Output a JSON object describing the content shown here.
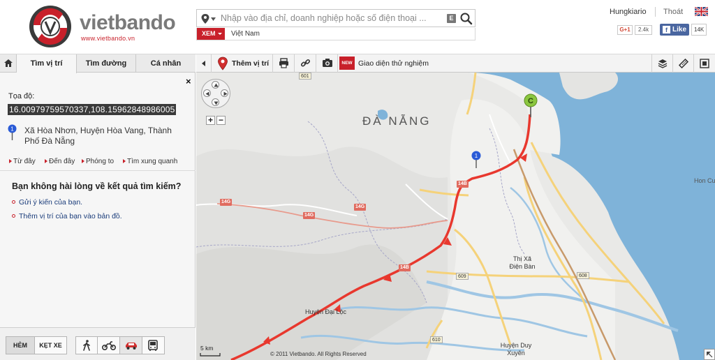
{
  "brand": {
    "name": "vietbando",
    "url": "www.vietbando.vn"
  },
  "search": {
    "placeholder": "Nhập vào địa chỉ, doanh nghiệp hoặc số điện thoại ...",
    "keyboard_label": "E",
    "view_label": "XEM",
    "area_value": "Việt Nam"
  },
  "account": {
    "username": "Hungkiario",
    "logout_label": "Thoát"
  },
  "social": {
    "gplus_label": "G+1",
    "gplus_count": "2.4k",
    "fb_label": "Like",
    "fb_count": "14K"
  },
  "left_tabs": [
    {
      "label": "Tìm vị trí"
    },
    {
      "label": "Tìm đường"
    },
    {
      "label": "Cá nhân"
    }
  ],
  "close_label": "×",
  "result": {
    "coord_label": "Tọa độ:",
    "coord_value": "16.00979759570337,108.15962848986005",
    "pin_number": "1",
    "address": "Xã Hòa Nhơn, Huyện Hòa Vang, Thành Phố Đà Nẵng",
    "actions": [
      {
        "label": "Từ đây"
      },
      {
        "label": "Đến đây"
      },
      {
        "label": "Phóng to"
      },
      {
        "label": "Tìm xung quanh"
      }
    ]
  },
  "feedback": {
    "title": "Bạn không hài lòng về kết quả tìm kiếm?",
    "links": [
      {
        "label": "Gửi ý kiến của bạn."
      },
      {
        "label": "Thêm vị trí của bạn vào bản đồ."
      }
    ]
  },
  "bottom": {
    "alley_label": "HẺM",
    "jam_label": "KẸT XE",
    "active_mode": "car"
  },
  "toolbar": {
    "add_location_label": "Thêm vị trí",
    "new_badge": "NEW",
    "trial_label": "Giao diện thử nghiệm"
  },
  "map": {
    "city_label": "ĐÀ NẴNG",
    "island_label": "Hon Cu",
    "districts": [
      {
        "label": "Thị Xã Điện Bàn"
      },
      {
        "label": "Huyện Đại Lộc"
      },
      {
        "label": "Huyện Duy Xuyên"
      }
    ],
    "shields_red": [
      "14B",
      "14B",
      "14G",
      "14G",
      "14G"
    ],
    "shields_yellow": [
      "601",
      "609",
      "608",
      "610"
    ],
    "marker_c": "C",
    "marker_1": "1",
    "scale_label": "5 km",
    "copyright": "© 2011 Vietbando. All Rights Reserved",
    "colors": {
      "water": "#7fb3d9",
      "land": "#e9e9e7",
      "route": "#e8382e",
      "road": "#f5d27a"
    }
  }
}
